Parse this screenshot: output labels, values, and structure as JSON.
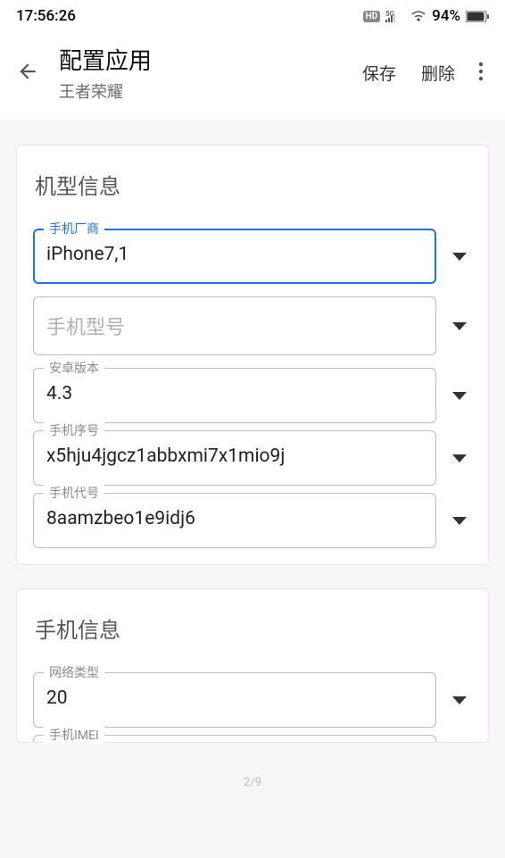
{
  "status": {
    "time": "17:56:26",
    "hd": "HD",
    "net": "5G",
    "battery": "94%"
  },
  "header": {
    "title": "配置应用",
    "subtitle": "王者荣耀",
    "save": "保存",
    "delete": "删除"
  },
  "section1": {
    "title": "机型信息",
    "fields": {
      "vendor": {
        "label": "手机厂商",
        "value": "iPhone7,1"
      },
      "model": {
        "label": "",
        "placeholder": "手机型号",
        "value": ""
      },
      "android": {
        "label": "安卓版本",
        "value": "4.3"
      },
      "serial": {
        "label": "手机序号",
        "value": "x5hju4jgcz1abbxmi7x1mio9j"
      },
      "codename": {
        "label": "手机代号",
        "value": "8aamzbeo1e9idj6"
      }
    }
  },
  "section2": {
    "title": "手机信息",
    "fields": {
      "nettype": {
        "label": "网络类型",
        "value": "20"
      },
      "imei": {
        "label": "手机IMEI"
      }
    }
  },
  "page": "2/9"
}
